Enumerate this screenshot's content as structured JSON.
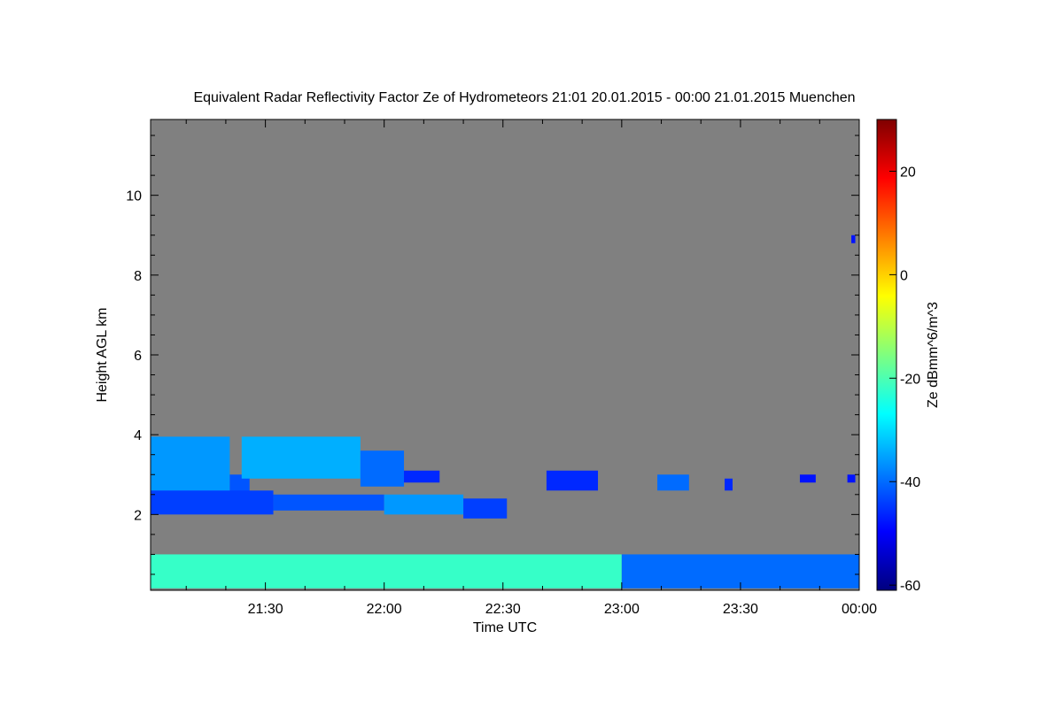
{
  "chart_data": {
    "type": "heatmap",
    "title": "Equivalent Radar Reflectivity Factor Ze of Hydrometeors   21:01 20.01.2015 - 00:00 21.01.2015 Muenchen",
    "xlabel": "Time UTC",
    "ylabel": "Height AGL km",
    "colorbar_label": "Ze dBmm^6/m^3",
    "xlim": [
      "21:01",
      "24:00"
    ],
    "ylim": [
      0.1,
      11.9
    ],
    "x_ticks": [
      {
        "value": "21:30",
        "label": "21:30"
      },
      {
        "value": "22:00",
        "label": "22:00"
      },
      {
        "value": "22:30",
        "label": "22:30"
      },
      {
        "value": "23:00",
        "label": "23:00"
      },
      {
        "value": "23:30",
        "label": "23:30"
      },
      {
        "value": "24:00",
        "label": "00:00"
      }
    ],
    "y_ticks": [
      2,
      4,
      6,
      8,
      10
    ],
    "colorbar_range": [
      -61,
      30
    ],
    "colorbar_ticks": [
      20,
      0,
      -20,
      -40,
      -60
    ],
    "background_color": "#808080",
    "colormap": [
      "#00007f",
      "#0000ff",
      "#007fff",
      "#00ffff",
      "#7fff7f",
      "#ffff00",
      "#ff7f00",
      "#ff0000",
      "#7f0000"
    ],
    "regions": [
      {
        "t0": "21:01",
        "t1": "21:21",
        "h0": 2.5,
        "h1": 3.95,
        "ze": -36
      },
      {
        "t0": "21:21",
        "t1": "21:26",
        "h0": 2.4,
        "h1": 3.0,
        "ze": -42
      },
      {
        "t0": "21:24",
        "t1": "21:54",
        "h0": 2.9,
        "h1": 3.95,
        "ze": -34
      },
      {
        "t0": "21:54",
        "t1": "22:05",
        "h0": 2.7,
        "h1": 3.6,
        "ze": -40
      },
      {
        "t0": "22:05",
        "t1": "22:14",
        "h0": 2.8,
        "h1": 3.1,
        "ze": -46
      },
      {
        "t0": "21:01",
        "t1": "21:32",
        "h0": 2.0,
        "h1": 2.6,
        "ze": -44
      },
      {
        "t0": "21:32",
        "t1": "22:00",
        "h0": 2.1,
        "h1": 2.5,
        "ze": -42
      },
      {
        "t0": "22:00",
        "t1": "22:20",
        "h0": 2.0,
        "h1": 2.5,
        "ze": -36
      },
      {
        "t0": "22:20",
        "t1": "22:31",
        "h0": 1.9,
        "h1": 2.4,
        "ze": -44
      },
      {
        "t0": "22:41",
        "t1": "22:54",
        "h0": 2.6,
        "h1": 3.1,
        "ze": -46
      },
      {
        "t0": "23:09",
        "t1": "23:17",
        "h0": 2.6,
        "h1": 3.0,
        "ze": -40
      },
      {
        "t0": "23:26",
        "t1": "23:28",
        "h0": 2.6,
        "h1": 2.9,
        "ze": -46
      },
      {
        "t0": "23:45",
        "t1": "23:49",
        "h0": 2.8,
        "h1": 3.0,
        "ze": -48
      },
      {
        "t0": "23:57",
        "t1": "23:59",
        "h0": 2.8,
        "h1": 3.0,
        "ze": -48
      },
      {
        "t0": "23:58",
        "t1": "23:59",
        "h0": 8.8,
        "h1": 9.0,
        "ze": -48
      },
      {
        "t0": "21:01",
        "t1": "23:00",
        "h0": 0.15,
        "h1": 1.0,
        "ze": -22
      },
      {
        "t0": "23:00",
        "t1": "24:00",
        "h0": 0.15,
        "h1": 1.0,
        "ze": -40
      }
    ]
  }
}
